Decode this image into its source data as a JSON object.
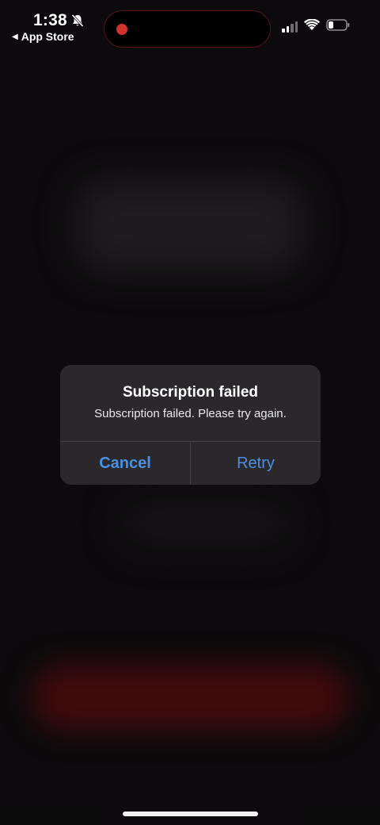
{
  "status_bar": {
    "time": "1:38",
    "back_label": "App Store",
    "icons": [
      "bell-slash-icon",
      "cellular-signal-icon",
      "wifi-icon",
      "battery-icon"
    ],
    "recording_color": "#d3312c"
  },
  "alert": {
    "title": "Subscription failed",
    "message": "Subscription failed. Please try again.",
    "cancel_label": "Cancel",
    "retry_label": "Retry",
    "button_color": "#4a90e2"
  }
}
